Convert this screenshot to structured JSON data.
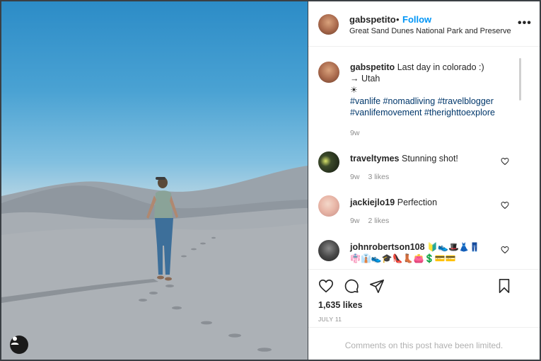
{
  "post": {
    "username": "gabspetito",
    "follow_separator": "•",
    "follow_label": "Follow",
    "location": "Great Sand Dunes National Park and Preserve",
    "more_label": "•••"
  },
  "caption": {
    "username": "gabspetito",
    "text_line1": "Last day in colorado :)",
    "text_line2": "→ Utah",
    "text_line3": "☀",
    "hashtags_line1": "#vanlife #nomadliving #travelblogger",
    "hashtags_line2": "#vanlifemovement #therighttoexplore",
    "age": "9w"
  },
  "comments": [
    {
      "username": "traveltymes",
      "text": "Stunning shot!",
      "age": "9w",
      "likes": "3 likes"
    },
    {
      "username": "jackiejlo19",
      "text": "Perfection",
      "age": "9w",
      "likes": "2 likes"
    },
    {
      "username": "johnrobertson108",
      "emoji_line1": "🔰👟🎩👗👖",
      "emoji_line2": "👘👔👟🎓👠👢👛💲💳💳"
    }
  ],
  "stats": {
    "likes": "1,635 likes",
    "date": "JULY 11"
  },
  "footer": {
    "limited_text": "Comments on this post have been limited."
  },
  "colors": {
    "accent": "#0095f6",
    "text": "#262626",
    "muted": "#8e8e8e"
  }
}
